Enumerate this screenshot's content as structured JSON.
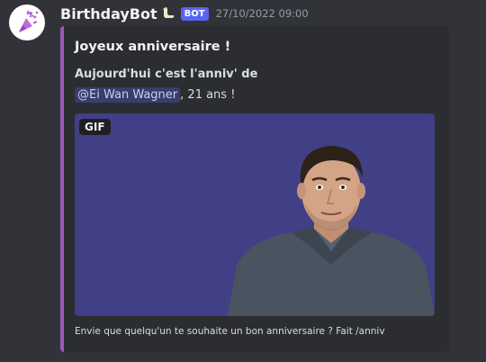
{
  "message": {
    "username": "BirthdayBot",
    "username_icon": "goose-icon",
    "bot_badge": "BOT",
    "timestamp": "27/10/2022 09:00"
  },
  "embed": {
    "accent_color": "#9b59b6",
    "title": "Joyeux anniversaire !",
    "description_line1": "Aujourd'hui c'est l'anniv' de",
    "mention": "@Ei Wan Wagner",
    "description_suffix": ", 21 ans !",
    "gif_badge": "GIF",
    "footer": "Envie que quelqu'un te souhaite un bon anniversaire ? Fait /anniv"
  },
  "colors": {
    "background": "#313338",
    "embed_background": "#2b2d31",
    "gif_background": "#413f86",
    "bot_badge": "#5865f2"
  }
}
